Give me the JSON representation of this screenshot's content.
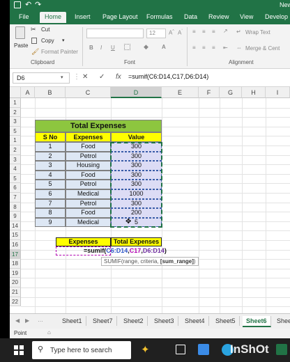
{
  "title": {
    "app_text": "New"
  },
  "ribbon_tabs": [
    "File",
    "Home",
    "Insert",
    "Page Layout",
    "Formulas",
    "Data",
    "Review",
    "View",
    "Develop"
  ],
  "active_tab": "Home",
  "clipboard": {
    "paste": "Paste",
    "cut": "Cut",
    "copy": "Copy",
    "format_painter": "Format Painter",
    "group": "Clipboard"
  },
  "font": {
    "size": "12",
    "bold": "B",
    "italic": "I",
    "underline": "U",
    "group": "Font"
  },
  "alignment": {
    "wrap_text": "Wrap Text",
    "merge": "Merge & Cent",
    "group": "Alignment"
  },
  "formula_bar": {
    "name_box": "D6",
    "cancel": "✕",
    "enter": "✓",
    "fx": "fx",
    "formula": "=sumif(C6:D14,C17,D6:D14)"
  },
  "columns": [
    "A",
    "B",
    "C",
    "D",
    "E",
    "F",
    "G",
    "H",
    "I"
  ],
  "rows": [
    "1",
    "2",
    "3",
    "5",
    "1",
    "2",
    "3",
    "4",
    "5",
    "6",
    "7",
    "8",
    "9",
    "14",
    "15",
    "16",
    "17",
    "18",
    "19",
    "20",
    "21",
    "22"
  ],
  "table": {
    "title": "Total Expenses",
    "headers": [
      "S No",
      "Expenses",
      "Value"
    ],
    "rows": [
      {
        "sno": "1",
        "expense": "Food",
        "value": "300"
      },
      {
        "sno": "2",
        "expense": "Petrol",
        "value": "300"
      },
      {
        "sno": "3",
        "expense": "Housing",
        "value": "300"
      },
      {
        "sno": "4",
        "expense": "Food",
        "value": "300"
      },
      {
        "sno": "5",
        "expense": "Petrol",
        "value": "300"
      },
      {
        "sno": "6",
        "expense": "Medical",
        "value": "1000"
      },
      {
        "sno": "7",
        "expense": "Petrol",
        "value": "300"
      },
      {
        "sno": "8",
        "expense": "Food",
        "value": "200"
      },
      {
        "sno": "9",
        "expense": "Medical",
        "value": "5"
      }
    ]
  },
  "summary": {
    "headers": [
      "Expenses",
      "Total Expenses"
    ],
    "formula_prefix": "=sumif(",
    "arg_range": "C6:D14",
    "arg_criteria": "C17",
    "arg_sum": "D6:D14",
    "formula_suffix": ")",
    "comma": ","
  },
  "tooltip": {
    "prefix": "SUMIF(range, criteria, ",
    "current": "[sum_range]",
    "suffix": ")"
  },
  "sheets": [
    "Sheet1",
    "Sheet7",
    "Sheet2",
    "Sheet3",
    "Sheet4",
    "Sheet5",
    "Sheet6",
    "Shee"
  ],
  "active_sheet": "Sheet6",
  "status": "Point",
  "taskbar": {
    "search_placeholder": "Type here to search",
    "watermark": "InShOt"
  },
  "colors": {
    "excel_green": "#217346",
    "title_fill": "#8dc63f",
    "header_fill": "#ffff00",
    "table_fill": "#dde7f4",
    "range_blue": "#2e56c8",
    "criteria_magenta": "#b000b0",
    "sumrange_purple": "#7030a0"
  }
}
